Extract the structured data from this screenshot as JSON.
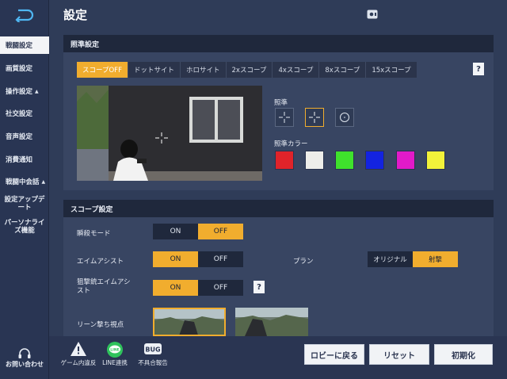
{
  "header": {
    "title": "設定"
  },
  "sidebar": {
    "items": [
      {
        "label": "戦闘設定",
        "active": true
      },
      {
        "label": "画質設定"
      },
      {
        "label": "操作設定",
        "arrow": "▲"
      },
      {
        "label": "社交設定"
      },
      {
        "label": "音声設定"
      },
      {
        "label": "消費通知"
      },
      {
        "label": "戦闘中会話",
        "arrow": "▲"
      },
      {
        "label": "設定アップデート"
      },
      {
        "label": "パーソナライズ機能"
      }
    ],
    "contact": "お問い合わせ"
  },
  "aim_panel": {
    "title": "照準設定",
    "scope_tabs": [
      "スコープOFF",
      "ドットサイト",
      "ホロサイト",
      "2xスコープ",
      "4xスコープ",
      "8xスコープ",
      "15xスコープ"
    ],
    "active_scope": "スコープOFF",
    "reticle_label": "照準",
    "reticle_color_label": "照準カラー",
    "colors": [
      "#e0232a",
      "#ededea",
      "#3fe22c",
      "#1323e0",
      "#e21ac9",
      "#f2f23a"
    ]
  },
  "scope_panel": {
    "title": "スコープ設定",
    "rows": {
      "continuous_fire": {
        "label": "瞬殺モード",
        "on": "ON",
        "off": "OFF",
        "value": "OFF"
      },
      "aim_assist": {
        "label": "エイムアシスト",
        "on": "ON",
        "off": "OFF",
        "value": "ON"
      },
      "sniper_assist": {
        "label": "狙撃銃エイムアシスト",
        "on": "ON",
        "off": "OFF",
        "value": "ON"
      },
      "plan": {
        "label": "プラン",
        "options": [
          "オリジナル",
          "射撃"
        ],
        "value": "射撃"
      },
      "lean": {
        "label": "リーン撃ち視点"
      }
    }
  },
  "bottom": {
    "report_cheat": "ゲーム内違反",
    "line": "LINE連携",
    "bug": "不具合報告",
    "bug_icon_text": "BUG",
    "line_icon_text": "LINE",
    "buttons": {
      "lobby": "ロビーに戻る",
      "reset": "リセット",
      "init": "初期化"
    }
  }
}
